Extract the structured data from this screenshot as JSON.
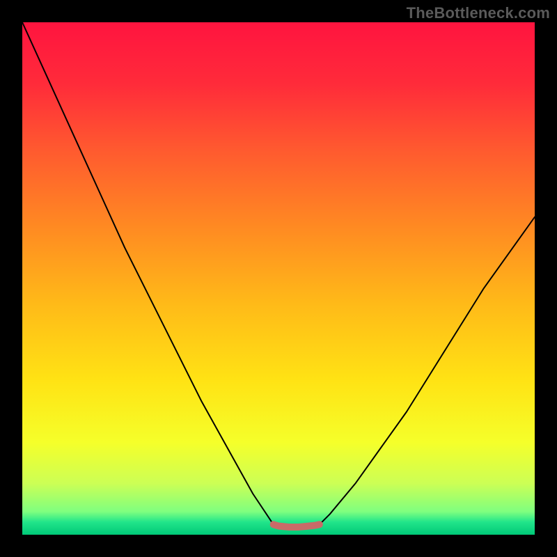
{
  "watermark": "TheBottleneck.com",
  "gradient": {
    "stops": [
      {
        "offset": 0.0,
        "color": "#ff143f"
      },
      {
        "offset": 0.12,
        "color": "#ff2b3a"
      },
      {
        "offset": 0.25,
        "color": "#ff5a2f"
      },
      {
        "offset": 0.4,
        "color": "#ff8a22"
      },
      {
        "offset": 0.55,
        "color": "#ffba18"
      },
      {
        "offset": 0.7,
        "color": "#ffe314"
      },
      {
        "offset": 0.82,
        "color": "#f5ff2a"
      },
      {
        "offset": 0.9,
        "color": "#ccff55"
      },
      {
        "offset": 0.955,
        "color": "#7fff7f"
      },
      {
        "offset": 0.975,
        "color": "#22e58a"
      },
      {
        "offset": 1.0,
        "color": "#00c978"
      }
    ]
  },
  "chart_data": {
    "type": "line",
    "title": "",
    "xlabel": "",
    "ylabel": "",
    "xlim": [
      0,
      100
    ],
    "ylim": [
      0,
      100
    ],
    "grid": false,
    "series": [
      {
        "name": "bottleneck-curve",
        "x": [
          0,
          5,
          10,
          15,
          20,
          25,
          30,
          35,
          40,
          45,
          49,
          50,
          51,
          53,
          55,
          57,
          58,
          60,
          65,
          70,
          75,
          80,
          85,
          90,
          95,
          100
        ],
        "values": [
          100,
          89,
          78,
          67,
          56,
          46,
          36,
          26,
          17,
          8,
          2,
          1.7,
          1.5,
          1.4,
          1.5,
          1.8,
          2.0,
          4,
          10,
          17,
          24,
          32,
          40,
          48,
          55,
          62
        ]
      },
      {
        "name": "flat-highlight",
        "x": [
          49,
          50,
          51,
          52,
          53,
          54,
          55,
          56,
          57,
          58
        ],
        "values": [
          2.0,
          1.7,
          1.6,
          1.5,
          1.5,
          1.5,
          1.6,
          1.7,
          1.8,
          2.0
        ]
      }
    ],
    "annotations": []
  },
  "styles": {
    "curve_stroke": "#000000",
    "curve_width": 2.0,
    "highlight_stroke": "#c96b68",
    "highlight_width": 10
  }
}
